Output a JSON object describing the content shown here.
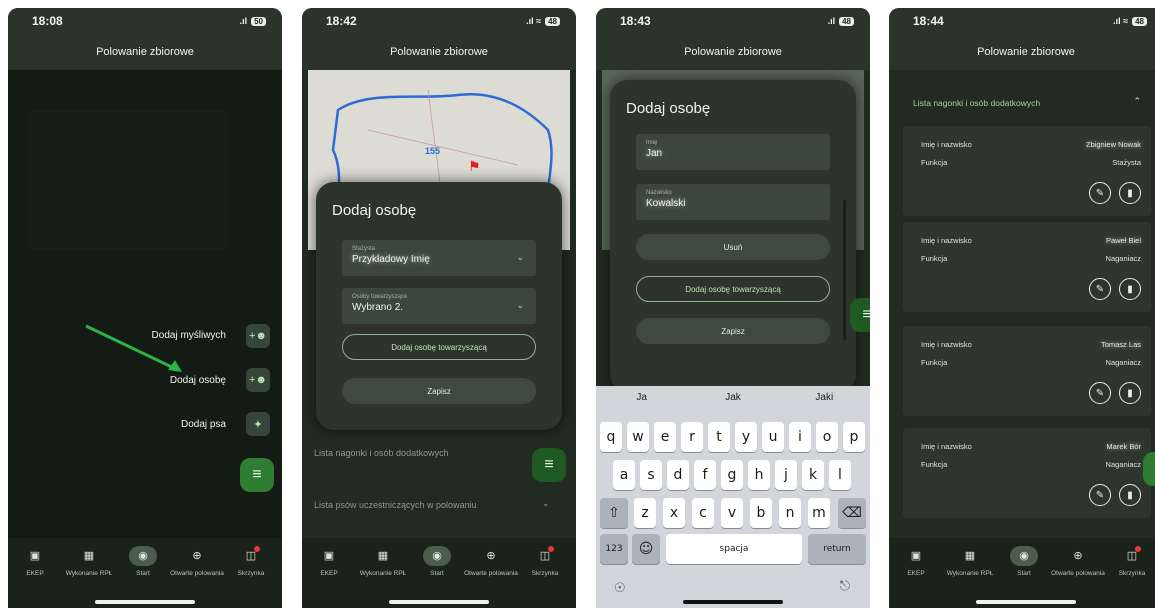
{
  "header_title": "Polowanie zbiorowe",
  "navbar": {
    "items": [
      {
        "label": "EKEP",
        "icon": "book-icon"
      },
      {
        "label": "Wykonanie RPŁ",
        "icon": "calendar-icon"
      },
      {
        "label": "Start",
        "icon": "home-icon"
      },
      {
        "label": "Otwarte polowania",
        "icon": "target-icon"
      },
      {
        "label": "Skrzynka",
        "icon": "inbox-icon"
      }
    ],
    "active": "Start"
  },
  "screen1": {
    "time": "18:08",
    "battery": "50",
    "menu": [
      {
        "label": "Dodaj myśliwych",
        "icon": "add-person-icon"
      },
      {
        "label": "Dodaj osobę",
        "icon": "add-person-icon"
      },
      {
        "label": "Dodaj psa",
        "icon": "dog-icon"
      }
    ],
    "fab_icon": "menu-icon"
  },
  "screen2": {
    "time": "18:42",
    "battery": "48",
    "map_number": "155",
    "sheet_title": "Dodaj osobę",
    "field1_label": "Stażysta",
    "field1_value": "Przykładowy Imię",
    "field2_label": "Osoby towarzyszące",
    "field2_value": "Wybrano 2.",
    "add_companion_button": "Dodaj osobę towarzyszącą",
    "save_button": "Zapisz",
    "section1": "Lista nagonki i osób dodatkowych",
    "section2": "Lista psów uczestniczących w polowaniu"
  },
  "screen3": {
    "time": "18:43",
    "battery": "48",
    "sheet_title": "Dodaj osobę",
    "field1_label": "Imię",
    "field1_value": "Jan",
    "field2_label": "Nazwisko",
    "field2_value": "Kowalski",
    "delete_button": "Usuń",
    "add_companion_button": "Dodaj osobę towarzyszącą",
    "save_button": "Zapisz",
    "suggestions": [
      "Ja",
      "Jak",
      "Jaki"
    ],
    "row1": [
      "q",
      "w",
      "e",
      "r",
      "t",
      "y",
      "u",
      "i",
      "o",
      "p"
    ],
    "row2": [
      "a",
      "s",
      "d",
      "f",
      "g",
      "h",
      "j",
      "k",
      "l"
    ],
    "row3": [
      "z",
      "x",
      "c",
      "v",
      "b",
      "n",
      "m"
    ],
    "numbers_key": "123",
    "space_key": "spacja",
    "return_key": "return"
  },
  "screen4": {
    "time": "18:44",
    "battery": "48",
    "section_title": "Lista nagonki i osób dodatkowych",
    "name_label": "Imię i nazwisko",
    "function_label": "Funkcja",
    "cards": [
      {
        "name": "Zbigniew Nowak",
        "function": "Stażysta"
      },
      {
        "name": "Paweł Biel",
        "function": "Naganiacz"
      },
      {
        "name": "Tomasz Las",
        "function": "Naganiacz"
      },
      {
        "name": "Marek Bór",
        "function": "Naganiacz"
      }
    ]
  }
}
